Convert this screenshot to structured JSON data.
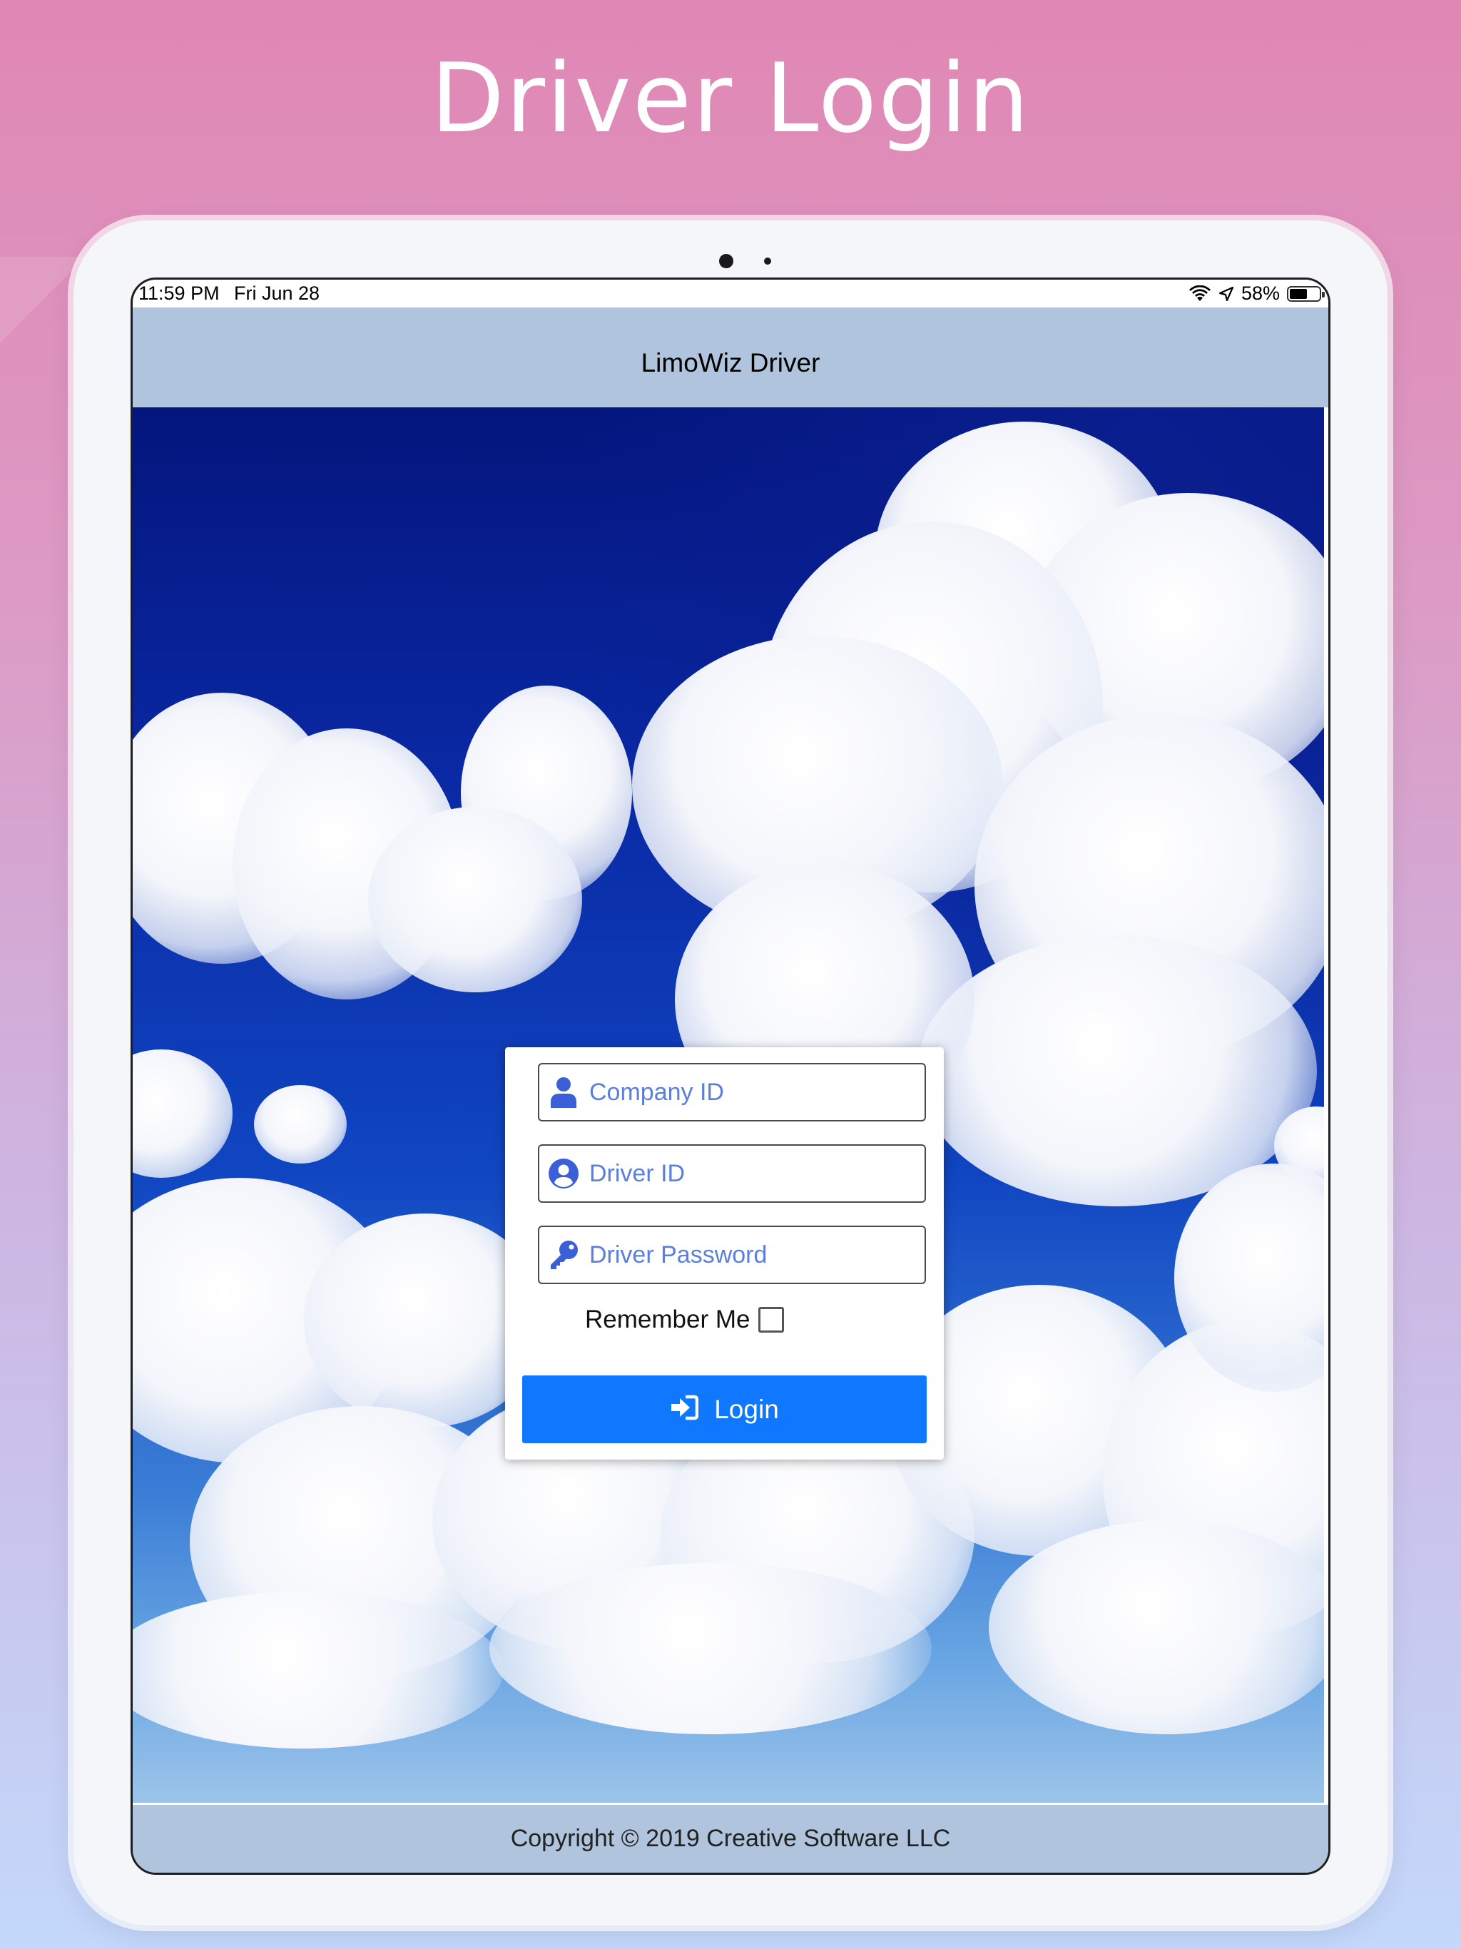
{
  "page": {
    "title": "Driver Login"
  },
  "status_bar": {
    "time": "11:59 PM",
    "date": "Fri Jun 28",
    "battery": "58%"
  },
  "nav": {
    "title": "LimoWiz Driver"
  },
  "login_form": {
    "company_id": {
      "placeholder": "Company ID",
      "value": "",
      "icon": "user-icon"
    },
    "driver_id": {
      "placeholder": "Driver ID",
      "value": "",
      "icon": "user-circle-icon"
    },
    "driver_password": {
      "placeholder": "Driver Password",
      "value": "",
      "icon": "key-icon"
    },
    "remember_me": {
      "label": "Remember Me",
      "checked": false
    },
    "login_button": {
      "label": "Login",
      "icon": "sign-in-icon"
    }
  },
  "footer": {
    "copyright": "Copyright © 2019 Creative Software LLC"
  },
  "colors": {
    "accent": "#0f78ff",
    "placeholder": "#5b7fdb",
    "icon": "#3a5fd6",
    "bar": "#b0c4de"
  }
}
